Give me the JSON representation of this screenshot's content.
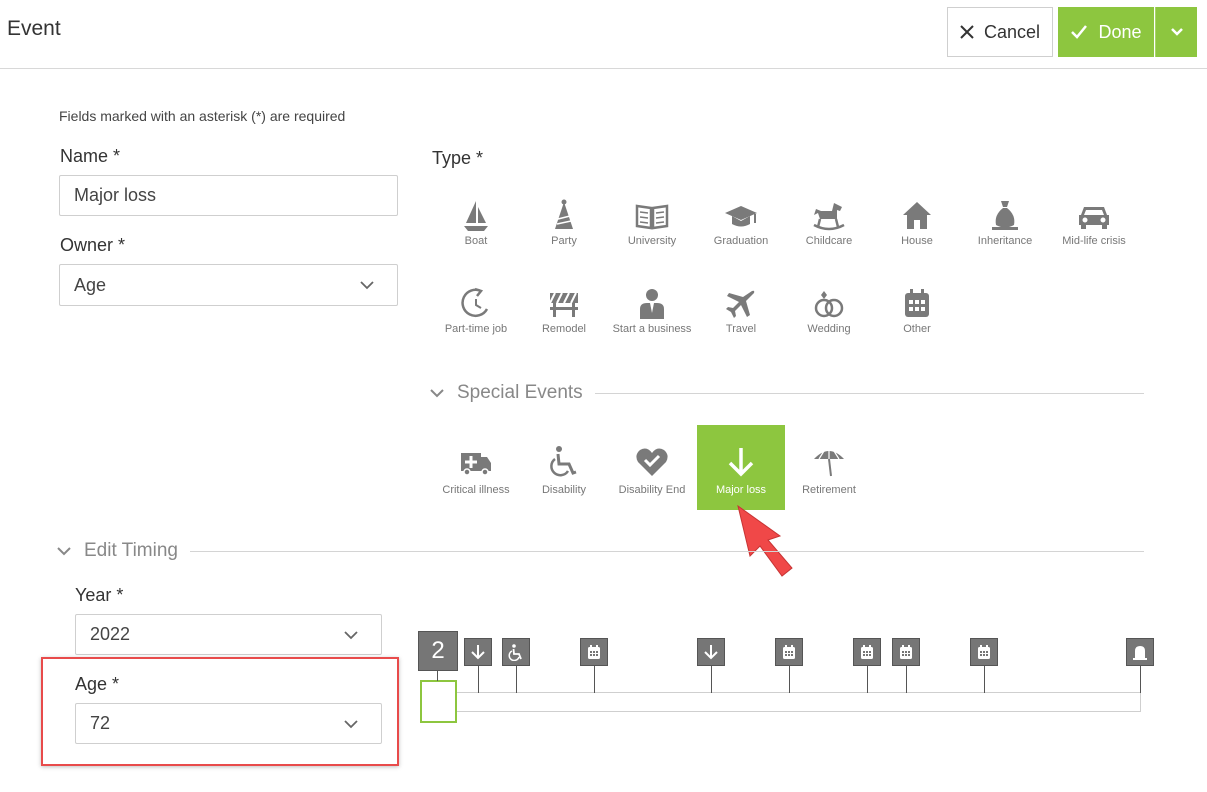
{
  "header": {
    "title": "Event",
    "cancel_label": "Cancel",
    "done_label": "Done"
  },
  "form": {
    "required_note": "Fields marked with an asterisk (*) are required",
    "name_label": "Name *",
    "name_value": "Major loss",
    "owner_label": "Owner *",
    "owner_value": "Age",
    "type_label": "Type *"
  },
  "types": [
    {
      "label": "Boat",
      "icon": "boat-icon"
    },
    {
      "label": "Party",
      "icon": "party-hat-icon"
    },
    {
      "label": "University",
      "icon": "book-icon"
    },
    {
      "label": "Graduation",
      "icon": "graduation-cap-icon"
    },
    {
      "label": "Childcare",
      "icon": "rocking-horse-icon"
    },
    {
      "label": "House",
      "icon": "house-icon"
    },
    {
      "label": "Inheritance",
      "icon": "money-bag-icon"
    },
    {
      "label": "Mid-life crisis",
      "icon": "car-icon"
    },
    {
      "label": "Part-time job",
      "icon": "clock-arrow-icon"
    },
    {
      "label": "Remodel",
      "icon": "barrier-icon"
    },
    {
      "label": "Start a business",
      "icon": "businessman-icon"
    },
    {
      "label": "Travel",
      "icon": "airplane-icon"
    },
    {
      "label": "Wedding",
      "icon": "rings-icon"
    },
    {
      "label": "Other",
      "icon": "calendar-icon"
    }
  ],
  "special_events": {
    "title": "Special Events",
    "items": [
      {
        "label": "Critical illness",
        "icon": "ambulance-icon"
      },
      {
        "label": "Disability",
        "icon": "wheelchair-icon"
      },
      {
        "label": "Disability End",
        "icon": "heart-check-icon"
      },
      {
        "label": "Major loss",
        "icon": "arrow-down-icon",
        "selected": true
      },
      {
        "label": "Retirement",
        "icon": "umbrella-icon"
      }
    ]
  },
  "timing": {
    "title": "Edit Timing",
    "year_label": "Year *",
    "year_value": "2022",
    "age_label": "Age *",
    "age_value": "72",
    "current_marker": "2"
  },
  "timeline_markers": [
    {
      "icon": "arrow-down-icon"
    },
    {
      "icon": "wheelchair-icon"
    },
    {
      "icon": "calendar-icon"
    },
    {
      "icon": "arrow-down-icon"
    },
    {
      "icon": "calendar-icon"
    },
    {
      "icon": "calendar-icon"
    },
    {
      "icon": "calendar-icon"
    },
    {
      "icon": "calendar-icon"
    },
    {
      "icon": "tombstone-icon"
    }
  ],
  "colors": {
    "accent": "#8dc63f",
    "highlight": "#e84b4b",
    "icon": "#7a7a7a"
  }
}
